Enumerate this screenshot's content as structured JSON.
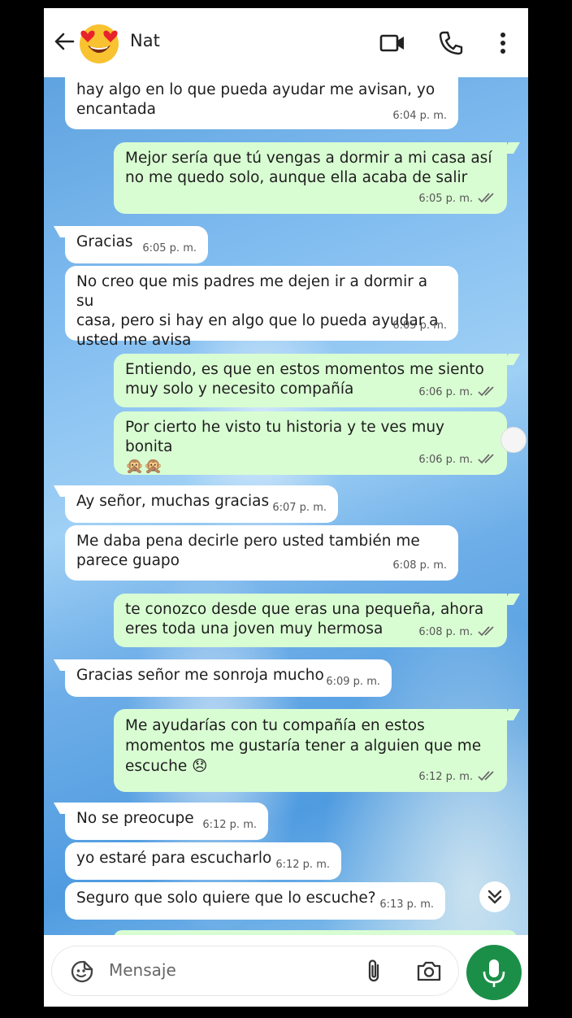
{
  "header": {
    "contact_name": "Nat",
    "avatar_icon": "heart-eyes-emoji",
    "icons": [
      "back-arrow-icon",
      "video-call-icon",
      "phone-call-icon",
      "more-vert-icon"
    ]
  },
  "messages": [
    {
      "dir": "in",
      "text": "hay algo en lo que pueda ayudar me avisan, yo\nencantada",
      "time": "6:04 p. m."
    },
    {
      "dir": "out",
      "text": "Mejor sería que tú vengas a dormir a mi casa así\nno me quedo solo, aunque ella acaba de salir",
      "time": "6:05 p. m."
    },
    {
      "dir": "in",
      "text": "Gracias",
      "time": "6:05 p. m."
    },
    {
      "dir": "in",
      "text": "No creo que mis padres me dejen ir a dormir a su\ncasa, pero si hay en algo que lo pueda ayudar a\nusted me avisa",
      "time": "6:05 p. m."
    },
    {
      "dir": "out",
      "text": "Entiendo, es que en estos momentos me siento\nmuy solo y necesito compañía",
      "time": "6:06 p. m."
    },
    {
      "dir": "out",
      "text": "Por cierto he visto tu historia y te ves muy bonita\n🙊🙊",
      "time": "6:06 p. m."
    },
    {
      "dir": "in",
      "text": "Ay señor, muchas gracias",
      "time": "6:07 p. m."
    },
    {
      "dir": "in",
      "text": "Me daba pena decirle pero usted también me\nparece guapo",
      "time": "6:08 p. m."
    },
    {
      "dir": "out",
      "text": "te conozco desde que eras una pequeña, ahora\neres toda una joven muy hermosa",
      "time": "6:08 p. m."
    },
    {
      "dir": "in",
      "text": "Gracias señor me sonroja mucho",
      "time": "6:09 p. m."
    },
    {
      "dir": "out",
      "text": "Me ayudarías con tu compañía en estos\nmomentos me gustaría tener a alguien que me\nescuche 😞",
      "time": "6:12 p. m."
    },
    {
      "dir": "in",
      "text": "No se preocupe",
      "time": "6:12 p. m."
    },
    {
      "dir": "in",
      "text": "yo estaré para escucharlo",
      "time": "6:12 p. m."
    },
    {
      "dir": "in",
      "text": "Seguro que solo quiere que lo escuche?",
      "time": "6:13 p. m."
    }
  ],
  "composer": {
    "placeholder": "Mensaje",
    "icons": [
      "emoji-sticker-icon",
      "attach-icon",
      "camera-icon",
      "mic-icon"
    ]
  },
  "colors": {
    "incoming_bubble": "#ffffff",
    "outgoing_bubble": "#d9fdd3",
    "mic_button": "#1b8f48",
    "read_ticks": "#6b6b6b"
  }
}
